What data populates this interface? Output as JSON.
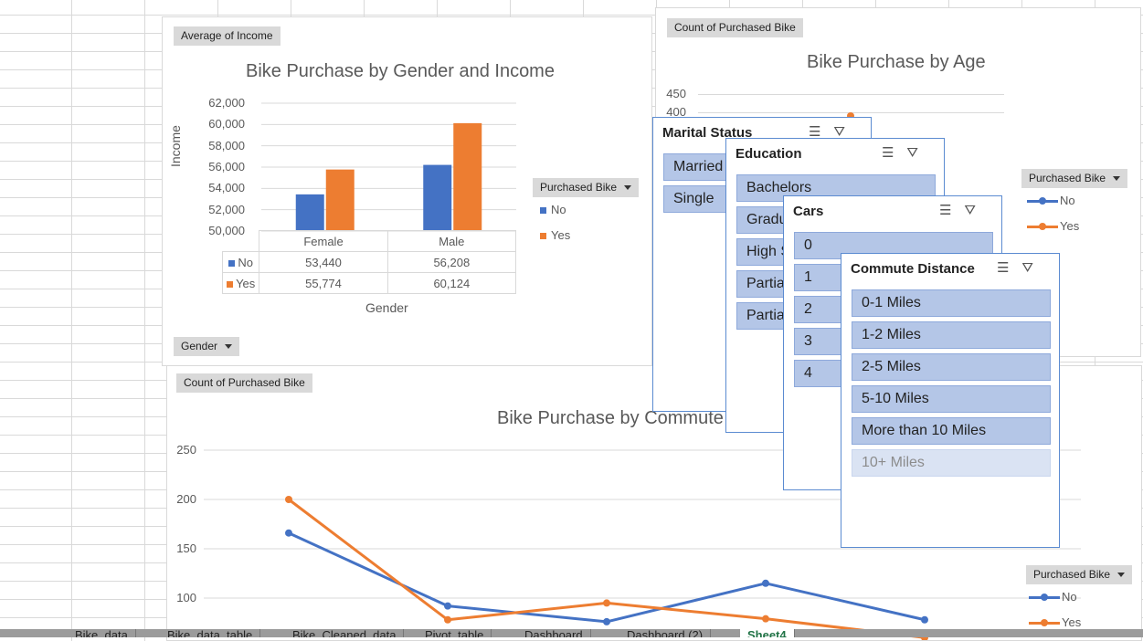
{
  "gender_income_chart": {
    "field_value_button": "Average of Income",
    "title": "Bike Purchase by Gender and Income",
    "y_axis_label": "Income",
    "x_axis_label": "Gender",
    "y_ticks": [
      "62,000",
      "60,000",
      "58,000",
      "56,000",
      "54,000",
      "52,000",
      "50,000"
    ],
    "legend_button": "Purchased Bike",
    "legend": [
      {
        "name": "No",
        "color": "#4472c4"
      },
      {
        "name": "Yes",
        "color": "#ed7d31"
      }
    ],
    "axis_button": "Gender",
    "table": {
      "headers": [
        "Female",
        "Male"
      ],
      "rows": [
        {
          "name": "No",
          "values": [
            "53,440",
            "56,208"
          ]
        },
        {
          "name": "Yes",
          "values": [
            "55,774",
            "60,124"
          ]
        }
      ]
    }
  },
  "age_chart": {
    "field_value_button": "Count of Purchased Bike",
    "title": "Bike Purchase by Age",
    "y_ticks": [
      "450",
      "400"
    ],
    "legend_button": "Purchased Bike",
    "legend": [
      {
        "name": "No",
        "color": "#4472c4"
      },
      {
        "name": "Yes",
        "color": "#ed7d31"
      }
    ]
  },
  "commute_chart": {
    "field_value_button": "Count of Purchased Bike",
    "title": "Bike Purchase by Commute",
    "y_ticks": [
      "250",
      "200",
      "150",
      "100"
    ],
    "legend_button": "Purchased Bike",
    "legend": [
      {
        "name": "No",
        "color": "#4472c4"
      },
      {
        "name": "Yes",
        "color": "#ed7d31"
      }
    ]
  },
  "slicers": {
    "marital_status": {
      "title": "Marital Status",
      "items": [
        "Married",
        "Single"
      ]
    },
    "education": {
      "title": "Education",
      "items": [
        "Bachelors",
        "Gradu",
        "High S",
        "Partia",
        "Partia"
      ]
    },
    "cars": {
      "title": "Cars",
      "items": [
        "0",
        "1",
        "2",
        "3",
        "4"
      ]
    },
    "commute_distance": {
      "title": "Commute Distance",
      "items": [
        "0-1 Miles",
        "1-2 Miles",
        "2-5 Miles",
        "5-10 Miles",
        "More than 10 Miles"
      ],
      "dim_items": [
        "10+ Miles"
      ]
    }
  },
  "sheet_tabs": [
    "Bike_data",
    "Bike_data_table",
    "Bike_Cleaned_data",
    "Pivot_table",
    "Dashboard",
    "Dashboard (2)",
    "Sheet4"
  ],
  "chart_data": [
    {
      "type": "bar",
      "title": "Bike Purchase by Gender and Income",
      "xlabel": "Gender",
      "ylabel": "Income",
      "categories": [
        "Female",
        "Male"
      ],
      "series": [
        {
          "name": "No",
          "values": [
            53440,
            56208
          ]
        },
        {
          "name": "Yes",
          "values": [
            55774,
            60124
          ]
        }
      ],
      "ylim": [
        50000,
        62000
      ],
      "legend": "right"
    },
    {
      "type": "line",
      "title": "Bike Purchase by Commute",
      "x": [
        1,
        2,
        3,
        4,
        5
      ],
      "series": [
        {
          "name": "No",
          "values": [
            166,
            92,
            76,
            115,
            78
          ]
        },
        {
          "name": "Yes",
          "values": [
            200,
            78,
            95,
            79,
            60
          ]
        }
      ],
      "ylim": [
        100,
        250
      ],
      "legend": "right"
    }
  ]
}
